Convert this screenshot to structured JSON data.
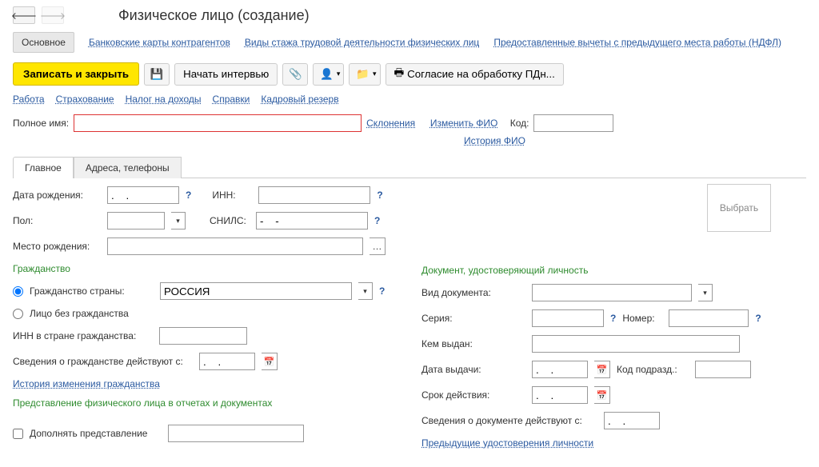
{
  "header": {
    "title": "Физическое лицо (создание)",
    "tabs": {
      "main": "Основное",
      "links": [
        "Банковские карты контрагентов",
        "Виды стажа трудовой деятельности физических лиц",
        "Предоставленные вычеты с предыдущего места работы (НДФЛ)"
      ]
    }
  },
  "cmdbar": {
    "save_close": "Записать и закрыть",
    "interview": "Начать интервью",
    "consent": "Согласие на обработку ПДн..."
  },
  "nav_links": [
    "Работа",
    "Страхование",
    "Налог на доходы",
    "Справки",
    "Кадровый резерв"
  ],
  "fullname": {
    "label": "Полное имя:",
    "value": "",
    "declension": "Склонения",
    "edit_fio": "Изменить ФИО",
    "code_label": "Код:",
    "code": "",
    "history": "История ФИО"
  },
  "pages": [
    "Главное",
    "Адреса, телефоны"
  ],
  "main": {
    "birth_label": "Дата рождения:",
    "birth": ".    .",
    "inn_label": "ИНН:",
    "inn": "",
    "gender_label": "Пол:",
    "gender": "",
    "snils_label": "СНИЛС:",
    "snils": "-    -",
    "birthplace_label": "Место рождения:",
    "birthplace": ""
  },
  "citizenship": {
    "title": "Гражданство",
    "country_label": "Гражданство страны:",
    "country": "РОССИЯ",
    "stateless": "Лицо без гражданства",
    "foreign_inn_label": "ИНН в стране гражданства:",
    "foreign_inn": "",
    "valid_from_label": "Сведения о гражданстве действуют с:",
    "valid_from": ".    .",
    "history": "История изменения гражданства",
    "repr_title": "Представление физического лица в отчетах и документах",
    "append_label": "Дополнять представление",
    "append": ""
  },
  "document": {
    "title": "Документ, удостоверяющий личность",
    "type_label": "Вид документа:",
    "type": "",
    "series_label": "Серия:",
    "series": "",
    "number_label": "Номер:",
    "number": "",
    "issued_by_label": "Кем выдан:",
    "issued_by": "",
    "issue_date_label": "Дата выдачи:",
    "issue_date": ".    .",
    "dept_code_label": "Код подразд.:",
    "dept_code": "",
    "expiry_label": "Срок действия:",
    "expiry": ".    .",
    "valid_from_label": "Сведения о документе действуют с:",
    "valid_from": ".    .",
    "prev_docs": "Предыдущие удостоверения личности"
  },
  "select_photo": "Выбрать"
}
